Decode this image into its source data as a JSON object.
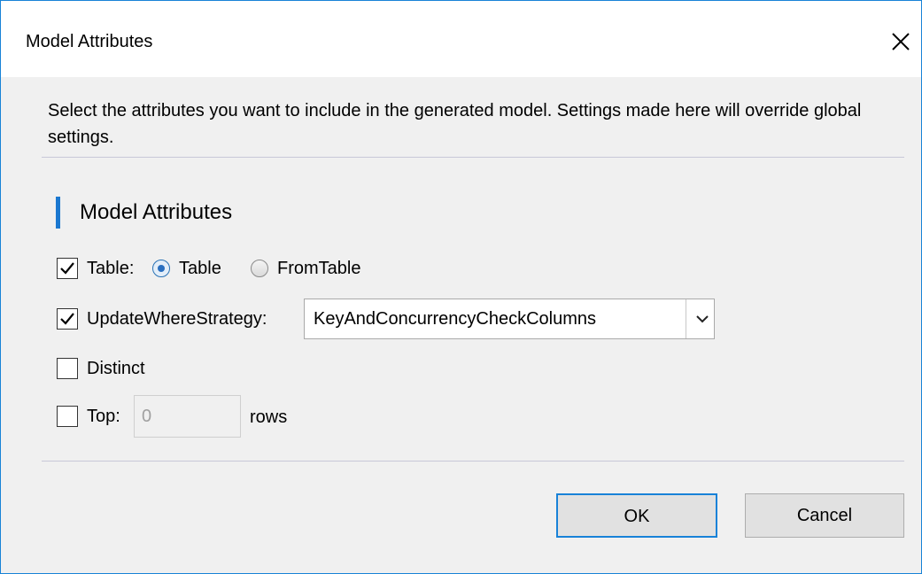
{
  "window": {
    "title": "Model Attributes"
  },
  "description": "Select the attributes you want to include in the generated model. Settings made here will override global settings.",
  "section": {
    "title": "Model Attributes",
    "accent_color": "#1b78d0"
  },
  "table_option": {
    "label": "Table:",
    "checked": true,
    "radio_options": [
      {
        "label": "Table",
        "selected": true
      },
      {
        "label": "FromTable",
        "selected": false
      }
    ]
  },
  "update_where": {
    "label": "UpdateWhereStrategy:",
    "checked": true,
    "selected_value": "KeyAndConcurrencyCheckColumns"
  },
  "distinct": {
    "label": "Distinct",
    "checked": false
  },
  "top": {
    "label": "Top:",
    "checked": false,
    "value": "0",
    "suffix": "rows"
  },
  "buttons": {
    "ok": "OK",
    "cancel": "Cancel"
  },
  "icons": {
    "close": "close-icon",
    "checkmark": "checkmark-icon",
    "dropdown": "chevron-down-icon"
  }
}
